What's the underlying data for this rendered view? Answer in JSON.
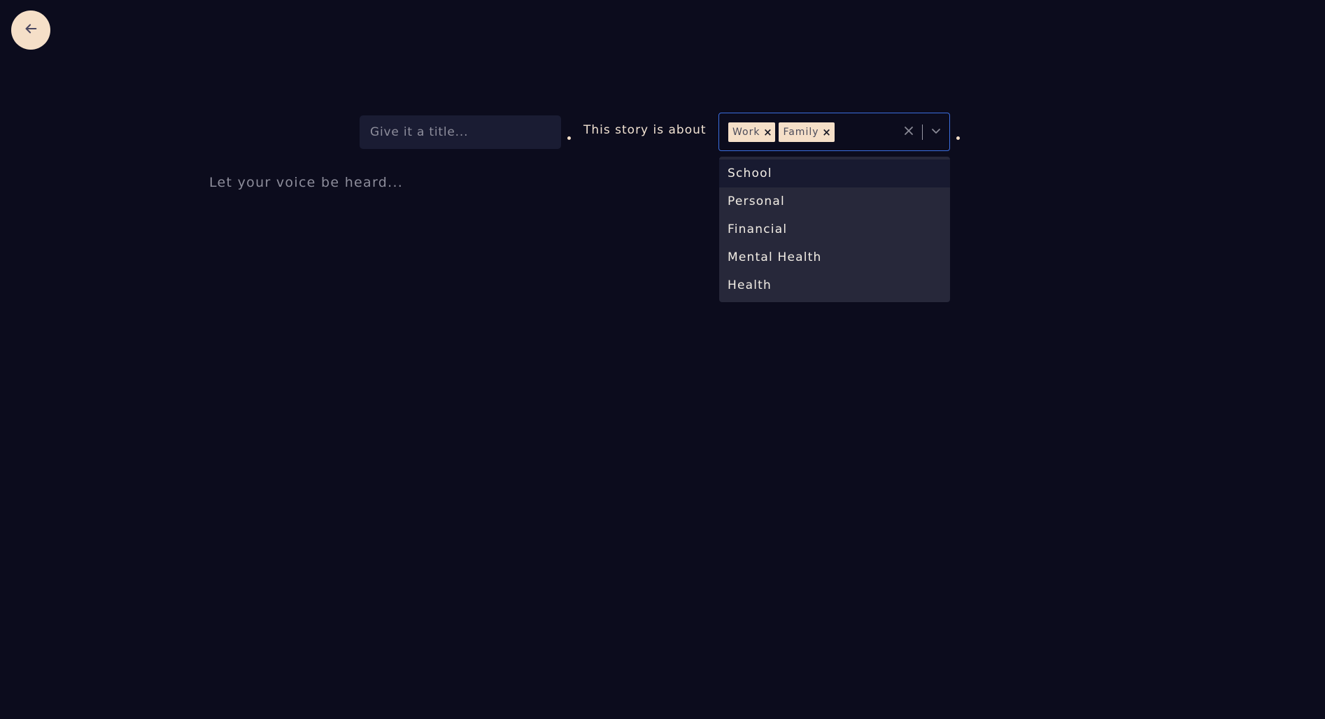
{
  "nav": {
    "back_icon": "arrow-left-icon"
  },
  "form": {
    "title_placeholder": "Give it a title...",
    "title_value": "",
    "story_label": "This story is about",
    "selected_tags": [
      {
        "label": "Work"
      },
      {
        "label": "Family"
      }
    ],
    "remove_glyph": "×",
    "clear_icon": "close-icon",
    "dropdown_icon": "chevron-down-icon",
    "options": [
      {
        "label": "School"
      },
      {
        "label": "Personal"
      },
      {
        "label": "Financial"
      },
      {
        "label": "Mental Health"
      },
      {
        "label": "Health"
      }
    ],
    "body_placeholder": "Let your voice be heard..."
  },
  "colors": {
    "background": "#0c0c1d",
    "accent": "#f5dfc8",
    "focus_border": "#3b6ee0",
    "menu_background": "#27283a"
  }
}
